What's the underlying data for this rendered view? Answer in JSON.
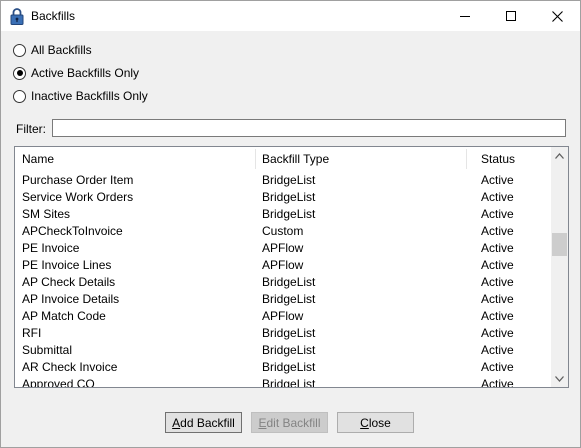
{
  "window": {
    "title": "Backfills",
    "icon": "padlock-icon"
  },
  "options": [
    {
      "label": "All Backfills",
      "checked": false
    },
    {
      "label": "Active Backfills Only",
      "checked": true
    },
    {
      "label": "Inactive Backfills Only",
      "checked": false
    }
  ],
  "filter": {
    "label": "Filter:",
    "value": ""
  },
  "grid": {
    "columns": [
      "Name",
      "Backfill Type",
      "Status"
    ],
    "rows": [
      {
        "name": "Purchase Order Item",
        "type": "BridgeList",
        "status": "Active"
      },
      {
        "name": "Service Work Orders",
        "type": "BridgeList",
        "status": "Active"
      },
      {
        "name": "SM Sites",
        "type": "BridgeList",
        "status": "Active"
      },
      {
        "name": "APCheckToInvoice",
        "type": "Custom",
        "status": "Active"
      },
      {
        "name": "PE Invoice",
        "type": "APFlow",
        "status": "Active"
      },
      {
        "name": "PE Invoice Lines",
        "type": "APFlow",
        "status": "Active"
      },
      {
        "name": "AP Check Details",
        "type": "BridgeList",
        "status": "Active"
      },
      {
        "name": "AP Invoice Details",
        "type": "BridgeList",
        "status": "Active"
      },
      {
        "name": "AP Match Code",
        "type": "APFlow",
        "status": "Active"
      },
      {
        "name": "RFI",
        "type": "BridgeList",
        "status": "Active"
      },
      {
        "name": "Submittal",
        "type": "BridgeList",
        "status": "Active"
      },
      {
        "name": "AR Check Invoice",
        "type": "BridgeList",
        "status": "Active"
      },
      {
        "name": "Approved CO",
        "type": "BridgeList",
        "status": "Active"
      }
    ]
  },
  "buttons": {
    "add": {
      "first": "A",
      "rest": "dd Backfill"
    },
    "edit": {
      "first": "E",
      "rest": "dit Backfill",
      "disabled": true
    },
    "close": {
      "first": "C",
      "rest": "lose"
    }
  }
}
